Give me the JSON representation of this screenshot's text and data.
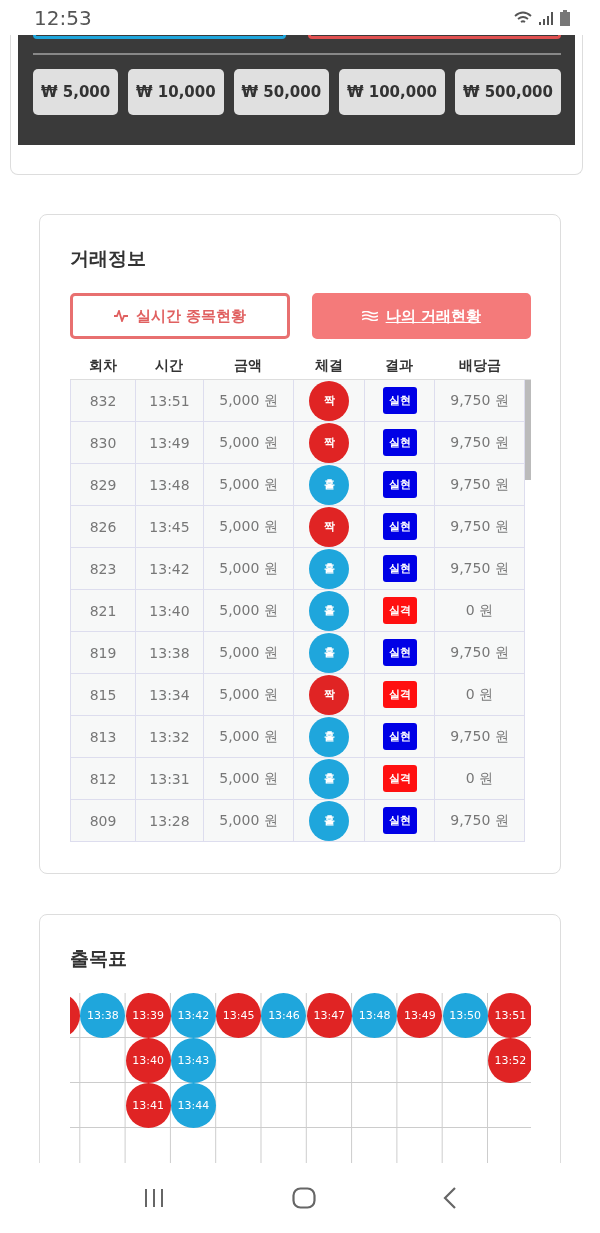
{
  "status_bar": {
    "time": "12:53"
  },
  "amount_buttons": [
    "₩ 5,000",
    "₩ 10,000",
    "₩ 50,000",
    "₩ 100,000",
    "₩ 500,000"
  ],
  "trade_info": {
    "title": "거래정보",
    "tabs": [
      {
        "label": "실시간 종목현황",
        "selected": false
      },
      {
        "label": "나의 거래현황",
        "selected": true
      }
    ],
    "columns": [
      "회차",
      "시간",
      "금액",
      "체결",
      "결과",
      "배당금"
    ],
    "rows": [
      {
        "round": "832",
        "time": "13:51",
        "amount": "5,000 원",
        "pick": {
          "label": "짝",
          "kind": "even"
        },
        "result": {
          "label": "실현",
          "kind": "win"
        },
        "payout": "9,750 원"
      },
      {
        "round": "830",
        "time": "13:49",
        "amount": "5,000 원",
        "pick": {
          "label": "짝",
          "kind": "even"
        },
        "result": {
          "label": "실현",
          "kind": "win"
        },
        "payout": "9,750 원"
      },
      {
        "round": "829",
        "time": "13:48",
        "amount": "5,000 원",
        "pick": {
          "label": "홀",
          "kind": "odd"
        },
        "result": {
          "label": "실현",
          "kind": "win"
        },
        "payout": "9,750 원"
      },
      {
        "round": "826",
        "time": "13:45",
        "amount": "5,000 원",
        "pick": {
          "label": "짝",
          "kind": "even"
        },
        "result": {
          "label": "실현",
          "kind": "win"
        },
        "payout": "9,750 원"
      },
      {
        "round": "823",
        "time": "13:42",
        "amount": "5,000 원",
        "pick": {
          "label": "홀",
          "kind": "odd"
        },
        "result": {
          "label": "실현",
          "kind": "win"
        },
        "payout": "9,750 원"
      },
      {
        "round": "821",
        "time": "13:40",
        "amount": "5,000 원",
        "pick": {
          "label": "홀",
          "kind": "odd"
        },
        "result": {
          "label": "실격",
          "kind": "lose"
        },
        "payout": "0 원"
      },
      {
        "round": "819",
        "time": "13:38",
        "amount": "5,000 원",
        "pick": {
          "label": "홀",
          "kind": "odd"
        },
        "result": {
          "label": "실현",
          "kind": "win"
        },
        "payout": "9,750 원"
      },
      {
        "round": "815",
        "time": "13:34",
        "amount": "5,000 원",
        "pick": {
          "label": "짝",
          "kind": "even"
        },
        "result": {
          "label": "실격",
          "kind": "lose"
        },
        "payout": "0 원"
      },
      {
        "round": "813",
        "time": "13:32",
        "amount": "5,000 원",
        "pick": {
          "label": "홀",
          "kind": "odd"
        },
        "result": {
          "label": "실현",
          "kind": "win"
        },
        "payout": "9,750 원"
      },
      {
        "round": "812",
        "time": "13:31",
        "amount": "5,000 원",
        "pick": {
          "label": "홀",
          "kind": "odd"
        },
        "result": {
          "label": "실격",
          "kind": "lose"
        },
        "payout": "0 원"
      },
      {
        "round": "809",
        "time": "13:28",
        "amount": "5,000 원",
        "pick": {
          "label": "홀",
          "kind": "odd"
        },
        "result": {
          "label": "실현",
          "kind": "win"
        },
        "payout": "9,750 원"
      }
    ]
  },
  "result_board": {
    "title": "출목표",
    "columns": [
      [
        {
          "color": "#e02424"
        }
      ],
      [
        {
          "time": "13:38",
          "color": "#1fa6dc"
        }
      ],
      [
        {
          "time": "13:39",
          "color": "#e02424"
        },
        {
          "time": "13:40",
          "color": "#e02424"
        },
        {
          "time": "13:41",
          "color": "#e02424"
        }
      ],
      [
        {
          "time": "13:42",
          "color": "#1fa6dc"
        },
        {
          "time": "13:43",
          "color": "#1fa6dc"
        },
        {
          "time": "13:44",
          "color": "#1fa6dc"
        }
      ],
      [
        {
          "time": "13:45",
          "color": "#e02424"
        }
      ],
      [
        {
          "time": "13:46",
          "color": "#1fa6dc"
        }
      ],
      [
        {
          "time": "13:47",
          "color": "#e02424"
        }
      ],
      [
        {
          "time": "13:48",
          "color": "#1fa6dc"
        }
      ],
      [
        {
          "time": "13:49",
          "color": "#e02424"
        }
      ],
      [
        {
          "time": "13:50",
          "color": "#1fa6dc"
        }
      ],
      [
        {
          "time": "13:51",
          "color": "#e02424"
        },
        {
          "time": "13:52",
          "color": "#e02424"
        }
      ]
    ]
  }
}
